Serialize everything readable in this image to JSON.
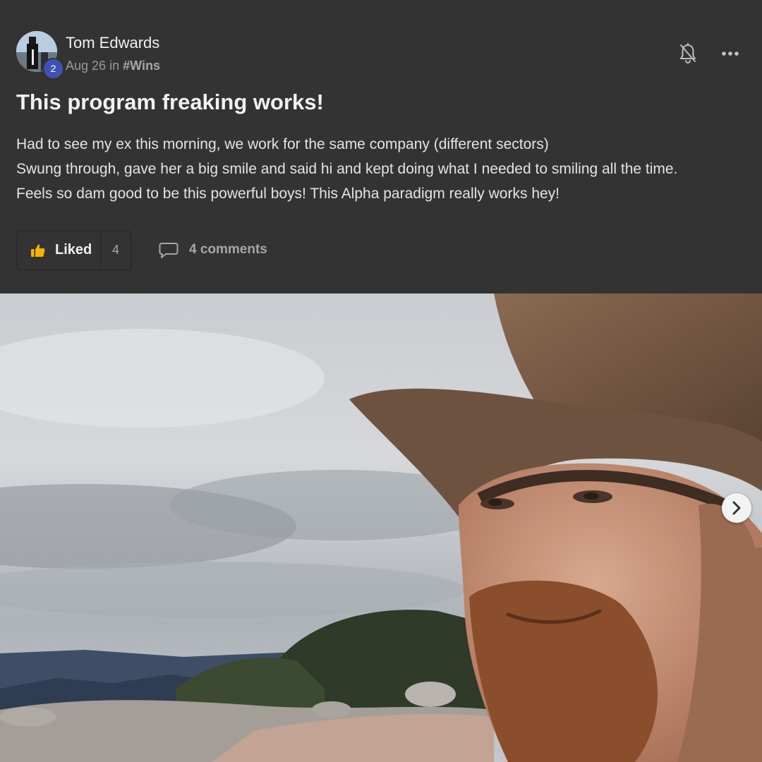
{
  "author": {
    "name": "Tom Edwards",
    "level": "2",
    "avatar_icon": "user-avatar-photo"
  },
  "meta": {
    "date": "Aug 26",
    "in_label": "in",
    "channel": "#Wins"
  },
  "header_actions": {
    "bell_icon": "bell-off-icon",
    "more_icon": "more-horizontal-icon"
  },
  "post": {
    "title": "This program freaking works!",
    "body_lines": [
      "Had to see my ex this morning, we work for the same company (different sectors)",
      "Swung through, gave her a big smile and said hi and kept doing what I needed to smiling all the time.",
      "Feels so dam good to be this powerful boys! This Alpha paradigm really works hey!"
    ]
  },
  "actions": {
    "like_label": "Liked",
    "like_count": "4",
    "like_icon": "thumbs-up-icon",
    "comments_label": "4 comments",
    "comments_icon": "comment-icon"
  },
  "media": {
    "description_icon": "post-photo",
    "next_icon": "chevron-right-icon"
  },
  "colors": {
    "background": "#333333",
    "badge": "#3f51b5",
    "like_thumb": "#f2b400",
    "text_primary": "#f0f0f0",
    "text_muted": "#9a9a9a"
  }
}
